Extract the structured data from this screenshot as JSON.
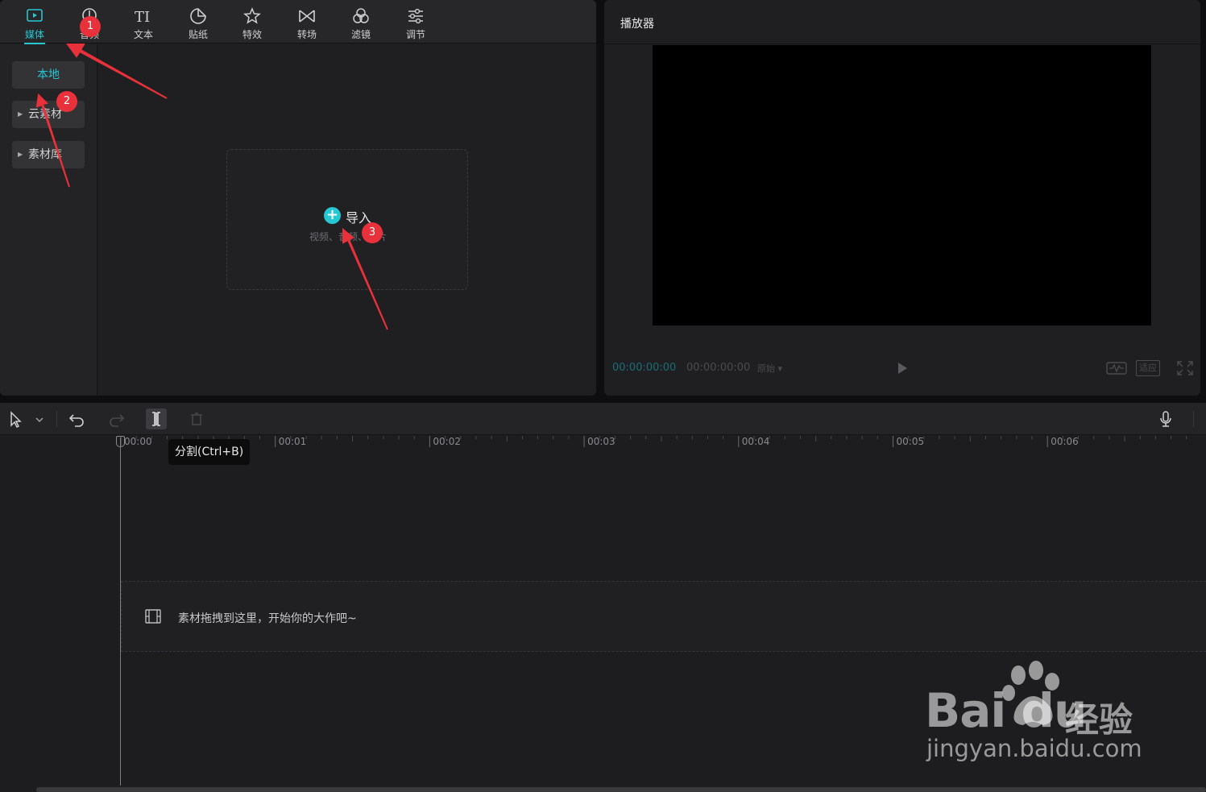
{
  "media_panel": {
    "tabs": [
      {
        "label": "媒体",
        "icon": "media-icon",
        "active": true
      },
      {
        "label": "音频",
        "icon": "audio-icon"
      },
      {
        "label": "文本",
        "icon": "text-icon"
      },
      {
        "label": "贴纸",
        "icon": "sticker-icon"
      },
      {
        "label": "特效",
        "icon": "effects-icon"
      },
      {
        "label": "转场",
        "icon": "transition-icon"
      },
      {
        "label": "滤镜",
        "icon": "filter-icon"
      },
      {
        "label": "调节",
        "icon": "adjust-icon"
      }
    ],
    "sidebar": {
      "local": "本地",
      "cloud": "云素材",
      "library": "素材库"
    },
    "import": {
      "title": "导入",
      "subtitle": "视频、音频、图片"
    }
  },
  "player": {
    "title": "播放器",
    "current_time": "00:00:00:00",
    "total_time": "00:00:00:00",
    "ratio": "原始",
    "fit_label": "适应"
  },
  "timeline": {
    "ticks": [
      "00:00",
      "00:01",
      "00:02",
      "00:03",
      "00:04",
      "00:05",
      "00:06"
    ],
    "tooltip": "分割(Ctrl+B)",
    "drop_hint": "素材拖拽到这里，开始你的大作吧~"
  },
  "annotations": [
    "1",
    "2",
    "3"
  ],
  "watermark": {
    "brand": "Bai du",
    "product": "经验",
    "url": "jingyan.baidu.com"
  },
  "colors": {
    "accent": "#25c7d3",
    "annotation": "#e8313b"
  }
}
